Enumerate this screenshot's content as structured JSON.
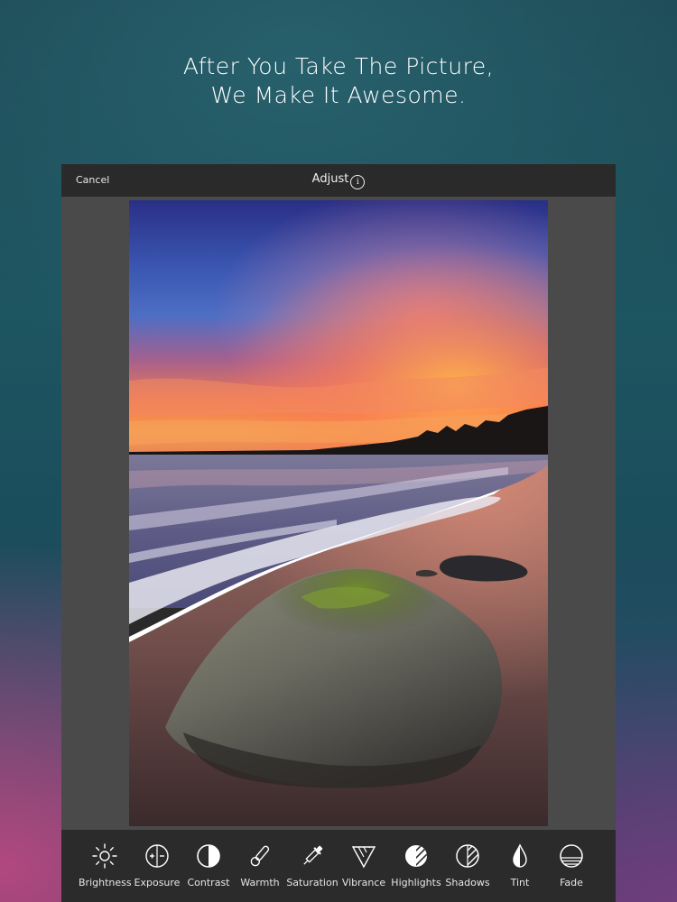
{
  "headline": {
    "line1": "After You Take The Picture,",
    "line2": "We Make It Awesome."
  },
  "editor": {
    "cancel_label": "Cancel",
    "title": "Adjust",
    "info_glyph": "i"
  },
  "photo": {
    "subject": "sunset-beach-rock-icon"
  },
  "tools": [
    {
      "label": "Brightness",
      "icon": "brightness-icon"
    },
    {
      "label": "Exposure",
      "icon": "exposure-icon"
    },
    {
      "label": "Contrast",
      "icon": "contrast-icon"
    },
    {
      "label": "Warmth",
      "icon": "warmth-icon"
    },
    {
      "label": "Saturation",
      "icon": "saturation-icon"
    },
    {
      "label": "Vibrance",
      "icon": "vibrance-icon"
    },
    {
      "label": "Highlights",
      "icon": "highlights-icon"
    },
    {
      "label": "Shadows",
      "icon": "shadows-icon"
    },
    {
      "label": "Tint",
      "icon": "tint-icon"
    },
    {
      "label": "Fade",
      "icon": "fade-icon"
    }
  ],
  "colors": {
    "toolbar_bg": "#2b2b2b",
    "canvas_bg": "#4a4a4a",
    "text": "#ffffff"
  }
}
